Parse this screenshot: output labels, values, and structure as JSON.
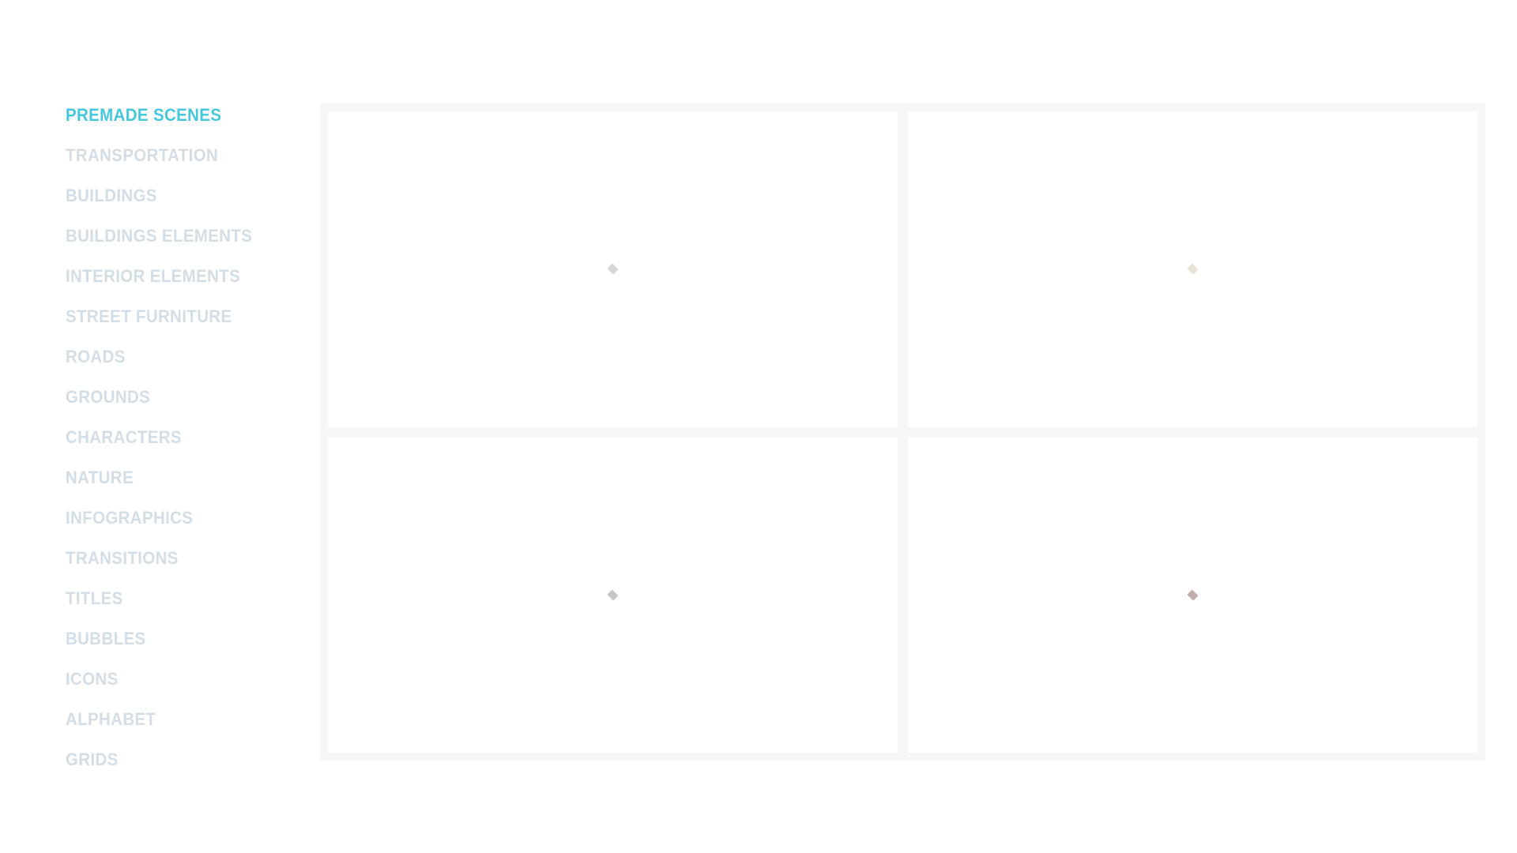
{
  "page": {
    "background_color": "#ffffff"
  },
  "sidebar": {
    "name": "category-list",
    "active_color": "#46c8dc",
    "inactive_color": "#d2dde5",
    "items": [
      {
        "label": "PREMADE SCENES",
        "active": true,
        "slug": "premade-scenes"
      },
      {
        "label": "TRANSPORTATION",
        "active": false,
        "slug": "transportation"
      },
      {
        "label": "BUILDINGS",
        "active": false,
        "slug": "buildings"
      },
      {
        "label": "BUILDINGS ELEMENTS",
        "active": false,
        "slug": "buildings-elements"
      },
      {
        "label": "INTERIOR ELEMENTS",
        "active": false,
        "slug": "interior-elements"
      },
      {
        "label": "STREET FURNITURE",
        "active": false,
        "slug": "street-furniture"
      },
      {
        "label": "ROADS",
        "active": false,
        "slug": "roads"
      },
      {
        "label": "GROUNDS",
        "active": false,
        "slug": "grounds"
      },
      {
        "label": "CHARACTERS",
        "active": false,
        "slug": "characters"
      },
      {
        "label": "NATURE",
        "active": false,
        "slug": "nature"
      },
      {
        "label": "INFOGRAPHICS",
        "active": false,
        "slug": "infographics"
      },
      {
        "label": "TRANSITIONS",
        "active": false,
        "slug": "transitions"
      },
      {
        "label": "TITLES",
        "active": false,
        "slug": "titles"
      },
      {
        "label": "BUBBLES",
        "active": false,
        "slug": "bubbles"
      },
      {
        "label": "ICONS",
        "active": false,
        "slug": "icons"
      },
      {
        "label": "ALPHABET",
        "active": false,
        "slug": "alphabet"
      },
      {
        "label": "GRIDS",
        "active": false,
        "slug": "grids"
      }
    ]
  },
  "main": {
    "name": "scene-grid",
    "background_color": "#f5f6f7",
    "cell_color": "#ffffff",
    "columns": 2,
    "rows": 2,
    "cells": [
      {
        "position": "top-left",
        "icon": "diamond-placeholder-icon",
        "icon_color": "#d6d6d6"
      },
      {
        "position": "top-right",
        "icon": "diamond-placeholder-icon",
        "icon_color": "#e8e3d4"
      },
      {
        "position": "bottom-left",
        "icon": "diamond-placeholder-icon",
        "icon_color": "#c9c6c3"
      },
      {
        "position": "bottom-right",
        "icon": "diamond-placeholder-icon",
        "icon_color": "#c3aeab"
      }
    ]
  }
}
